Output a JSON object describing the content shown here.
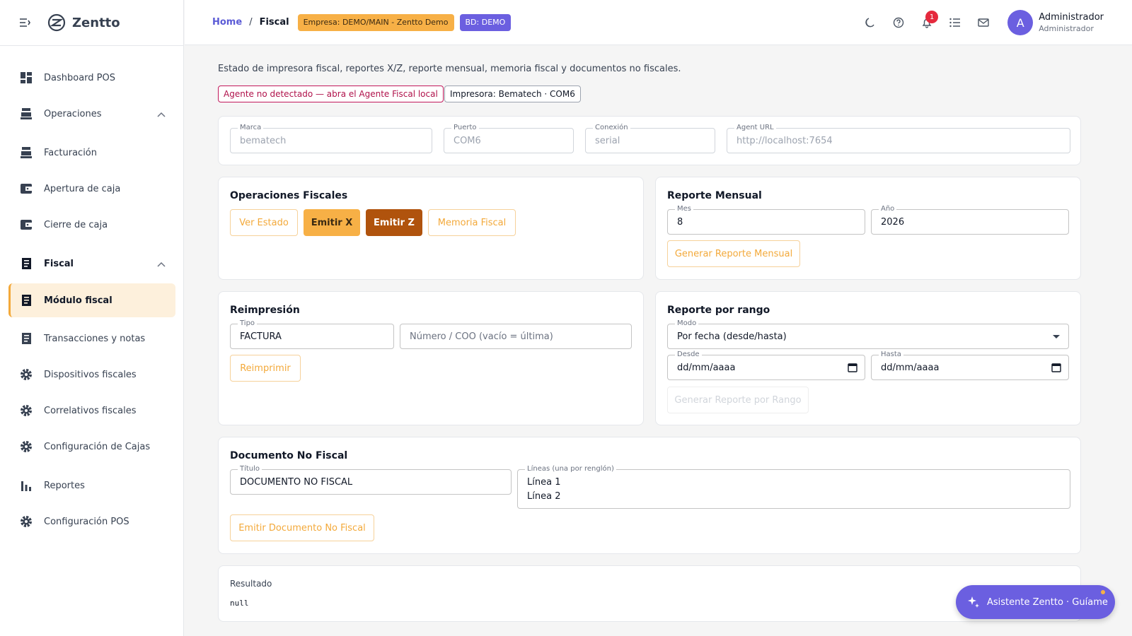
{
  "brand": {
    "name": "Zentto"
  },
  "sidebar": {
    "items": [
      {
        "label": "Dashboard POS",
        "icon": "dashboard-icon"
      },
      {
        "label": "Operaciones",
        "icon": "register-icon"
      },
      {
        "label": "Facturación",
        "icon": "register-icon"
      },
      {
        "label": "Apertura de caja",
        "icon": "wallet-icon"
      },
      {
        "label": "Cierre de caja",
        "icon": "wallet-icon"
      },
      {
        "label": "Fiscal",
        "icon": "receipt-icon"
      },
      {
        "label": "Módulo fiscal",
        "icon": "receipt-icon"
      },
      {
        "label": "Transacciones y notas",
        "icon": "receipt-icon"
      },
      {
        "label": "Dispositivos fiscales",
        "icon": "gear-icon"
      },
      {
        "label": "Correlativos fiscales",
        "icon": "gear-icon"
      },
      {
        "label": "Configuración de Cajas",
        "icon": "gear-icon"
      },
      {
        "label": "Reportes",
        "icon": "bar-chart-icon"
      },
      {
        "label": "Configuración POS",
        "icon": "gear-icon"
      }
    ]
  },
  "header": {
    "breadcrumb_home": "Home",
    "breadcrumb_sep": "/",
    "breadcrumb_current": "Fiscal",
    "empresa_chip": "Empresa: DEMO/MAIN - Zentto Demo",
    "bd_chip": "BD: DEMO",
    "notifications_count": "1",
    "user_name": "Administrador",
    "user_role": "Administrador",
    "avatar_letter": "A"
  },
  "main": {
    "description": "Estado de impresora fiscal, reportes X/Z, reporte mensual, memoria fiscal y documentos no fiscales.",
    "agent_status": "Agente no detectado — abra el Agente Fiscal local",
    "printer_status": "Impresora: Bematech · COM6",
    "config": {
      "marca_label": "Marca",
      "marca_value": "bematech",
      "puerto_label": "Puerto",
      "puerto_value": "COM6",
      "conexion_label": "Conexión",
      "conexion_value": "serial",
      "agent_url_label": "Agent URL",
      "agent_url_value": "http://localhost:7654"
    },
    "operaciones": {
      "title": "Operaciones Fiscales",
      "ver_estado": "Ver Estado",
      "emitir_x": "Emitir X",
      "emitir_z": "Emitir Z",
      "memoria_fiscal": "Memoria Fiscal"
    },
    "mensual": {
      "title": "Reporte Mensual",
      "mes_label": "Mes",
      "mes_value": "8",
      "anio_label": "Año",
      "anio_value": "2026",
      "generar": "Generar Reporte Mensual"
    },
    "reimpresion": {
      "title": "Reimpresión",
      "tipo_label": "Tipo",
      "tipo_value": "FACTURA",
      "numero_placeholder": "Número / COO (vacío = última)",
      "reimprimir": "Reimprimir"
    },
    "rango": {
      "title": "Reporte por rango",
      "modo_label": "Modo",
      "modo_value": "Por fecha (desde/hasta)",
      "desde_label": "Desde",
      "desde_value": "dd/mm/aaaa",
      "hasta_label": "Hasta",
      "hasta_value": "dd/mm/aaaa",
      "generar": "Generar Reporte por Rango"
    },
    "no_fiscal": {
      "title": "Documento No Fiscal",
      "titulo_label": "Título",
      "titulo_value": "DOCUMENTO NO FISCAL",
      "lineas_label": "Líneas (una por renglón)",
      "linea_1": "Línea 1",
      "linea_2": "Línea 2",
      "emitir": "Emitir Documento No Fiscal"
    },
    "resultado": {
      "label": "Resultado",
      "value": "null"
    }
  },
  "assistant": {
    "label": "Asistente Zentto · Guíame"
  },
  "colors": {
    "accent": "#f7b046",
    "primary": "#6b5fe0",
    "dark_accent": "#b0530d",
    "error": "#c2185b"
  }
}
